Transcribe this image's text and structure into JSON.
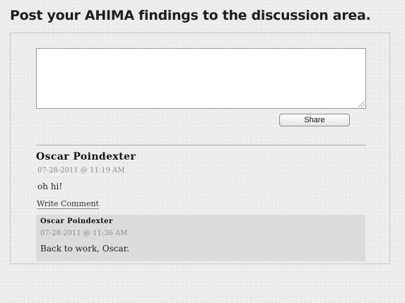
{
  "page": {
    "heading": "Post your AHIMA findings to the discussion area."
  },
  "composer": {
    "textarea_value": "",
    "share_label": "Share"
  },
  "comment": {
    "author": "Oscar Poindexter",
    "timestamp": "07-28-2011 @ 11:19 AM",
    "body": "oh hi!",
    "write_comment_label": "Write Comment"
  },
  "reply": {
    "author": "Oscar Poindexter",
    "timestamp": "07-28-2011 @ 11:36 AM",
    "body": "Back to work, Oscar."
  },
  "colors": {
    "background": "#ececec",
    "reply_background": "#dcdcdc",
    "timestamp": "#8c8c8c"
  }
}
